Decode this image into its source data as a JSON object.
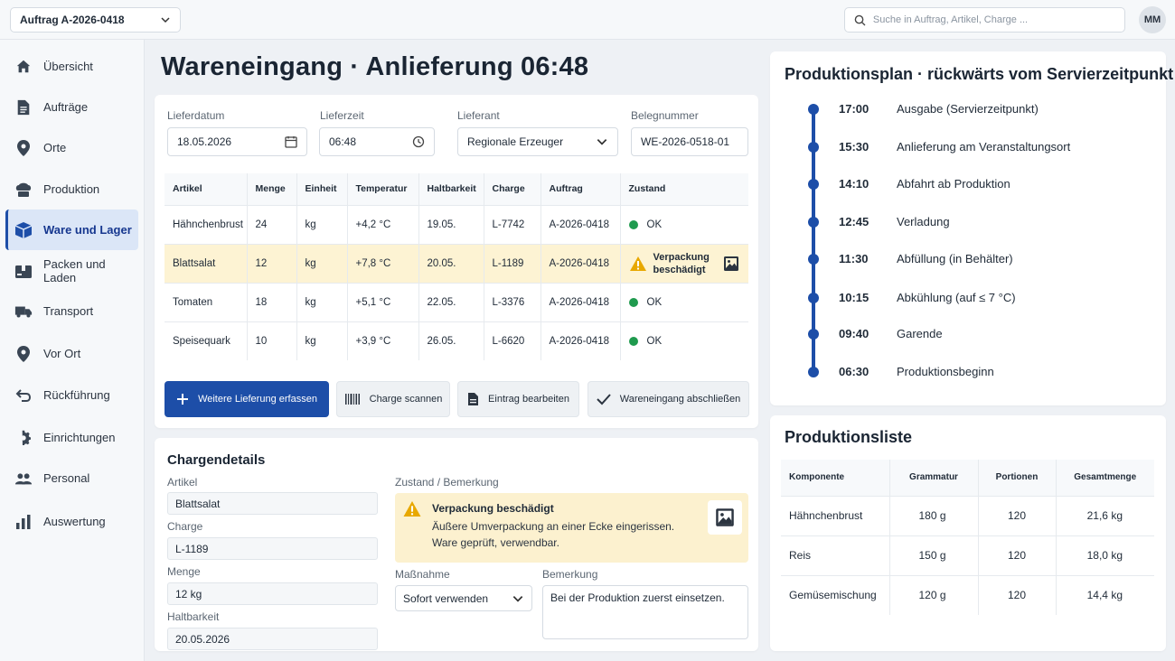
{
  "topbar": {
    "order_select": "Auftrag A-2026-0418",
    "search_placeholder": "Suche in Auftrag, Artikel, Charge ...",
    "avatar": "MM"
  },
  "sidebar": {
    "items": [
      {
        "label": "Übersicht",
        "icon": "home-icon"
      },
      {
        "label": "Aufträge",
        "icon": "document-icon"
      },
      {
        "label": "Orte",
        "icon": "location-pin-icon"
      },
      {
        "label": "Produktion",
        "icon": "chef-hat-icon"
      },
      {
        "label": "Ware und Lager",
        "icon": "box-icon",
        "active": true
      },
      {
        "label": "Packen und Laden",
        "icon": "package-icon"
      },
      {
        "label": "Transport",
        "icon": "truck-icon"
      },
      {
        "label": "Vor Ort",
        "icon": "location-pin-icon"
      },
      {
        "label": "Rückführung",
        "icon": "return-arrow-icon"
      },
      {
        "label": "Einrichtungen",
        "icon": "gear-icon"
      },
      {
        "label": "Personal",
        "icon": "people-icon"
      },
      {
        "label": "Auswertung",
        "icon": "bar-chart-icon"
      }
    ]
  },
  "page": {
    "title": "Wareneingang · Anlieferung 06:48"
  },
  "delivery_form": {
    "lieferdatum_label": "Lieferdatum",
    "lieferdatum_value": "18.05.2026",
    "lieferzeit_label": "Lieferzeit",
    "lieferzeit_value": "06:48",
    "lieferant_label": "Lieferant",
    "lieferant_value": "Regionale Erzeuger",
    "belegnummer_label": "Belegnummer",
    "belegnummer_value": "WE-2026-0518-01"
  },
  "delivery_table": {
    "headers": [
      "Artikel",
      "Menge",
      "Einheit",
      "Temperatur",
      "Haltbarkeit",
      "Charge",
      "Auftrag",
      "Zustand"
    ],
    "rows": [
      {
        "artikel": "Hähnchenbrust",
        "menge": "24",
        "einheit": "kg",
        "temperatur": "+4,2 °C",
        "haltbarkeit": "19.05.",
        "charge": "L-7742",
        "auftrag": "A-2026-0418",
        "zustand": "OK",
        "status": "ok"
      },
      {
        "artikel": "Blattsalat",
        "menge": "12",
        "einheit": "kg",
        "temperatur": "+7,8 °C",
        "haltbarkeit": "20.05.",
        "charge": "L-1189",
        "auftrag": "A-2026-0418",
        "zustand_line1": "Verpackung",
        "zustand_line2": "beschädigt",
        "status": "warn"
      },
      {
        "artikel": "Tomaten",
        "menge": "18",
        "einheit": "kg",
        "temperatur": "+5,1 °C",
        "haltbarkeit": "22.05.",
        "charge": "L-3376",
        "auftrag": "A-2026-0418",
        "zustand": "OK",
        "status": "ok"
      },
      {
        "artikel": "Speisequark",
        "menge": "10",
        "einheit": "kg",
        "temperatur": "+3,9 °C",
        "haltbarkeit": "26.05.",
        "charge": "L-6620",
        "auftrag": "A-2026-0418",
        "zustand": "OK",
        "status": "ok"
      }
    ]
  },
  "actions": {
    "add": "Weitere Lieferung erfassen",
    "scan": "Charge scannen",
    "edit": "Eintrag bearbeiten",
    "complete": "Wareneingang abschließen"
  },
  "batch_details": {
    "title": "Chargendetails",
    "artikel_label": "Artikel",
    "artikel_value": "Blattsalat",
    "charge_label": "Charge",
    "charge_value": "L-1189",
    "menge_label": "Menge",
    "menge_value": "12 kg",
    "haltbarkeit_label": "Haltbarkeit",
    "haltbarkeit_value": "20.05.2026",
    "zustand_label": "Zustand / Bemerkung",
    "warn_title": "Verpackung beschädigt",
    "warn_line1": "Äußere Umverpackung an einer Ecke eingerissen.",
    "warn_line2": "Ware geprüft, verwendbar.",
    "massnahme_label": "Maßnahme",
    "massnahme_value": "Sofort verwenden",
    "bemerkung_label": "Bemerkung",
    "bemerkung_value": "Bei der Produktion zuerst einsetzen."
  },
  "production_plan": {
    "title": "Produktionsplan · rückwärts vom Servierzeitpunkt",
    "steps": [
      {
        "time": "17:00",
        "label": "Ausgabe (Servierzeitpunkt)"
      },
      {
        "time": "15:30",
        "label": "Anlieferung am Veranstaltungsort"
      },
      {
        "time": "14:10",
        "label": "Abfahrt ab Produktion"
      },
      {
        "time": "12:45",
        "label": "Verladung"
      },
      {
        "time": "11:30",
        "label": "Abfüllung (in Behälter)"
      },
      {
        "time": "10:15",
        "label": "Abkühlung (auf ≤ 7 °C)"
      },
      {
        "time": "09:40",
        "label": "Garende"
      },
      {
        "time": "06:30",
        "label": "Produktionsbeginn"
      }
    ]
  },
  "production_list": {
    "title": "Produktionsliste",
    "headers": [
      "Komponente",
      "Grammatur",
      "Portionen",
      "Gesamtmenge"
    ],
    "rows": [
      {
        "komponente": "Hähnchenbrust",
        "grammatur": "180 g",
        "portionen": "120",
        "gesamt": "21,6 kg"
      },
      {
        "komponente": "Reis",
        "grammatur": "150 g",
        "portionen": "120",
        "gesamt": "18,0 kg"
      },
      {
        "komponente": "Gemüsemischung",
        "grammatur": "120 g",
        "portionen": "120",
        "gesamt": "14,4 kg"
      }
    ]
  },
  "colors": {
    "primary": "#1d4ea8",
    "ok": "#1f9a4e",
    "warn_bg": "#fdf3d3",
    "warn_icon": "#e8a800"
  }
}
